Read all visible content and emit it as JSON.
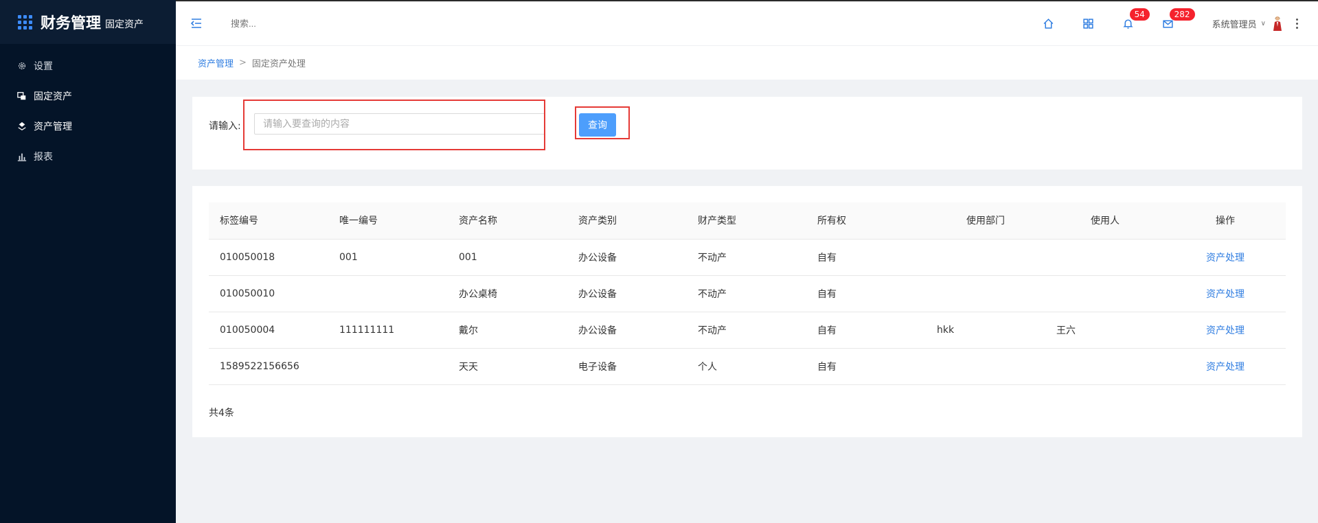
{
  "app": {
    "title": "财务管理",
    "subtitle": "固定资产"
  },
  "sidebar": {
    "items": [
      {
        "label": "设置",
        "icon": "gear-icon"
      },
      {
        "label": "固定资产",
        "icon": "assets-icon"
      },
      {
        "label": "资产管理",
        "icon": "stack-icon"
      },
      {
        "label": "报表",
        "icon": "bar-chart-icon"
      }
    ]
  },
  "header": {
    "search_placeholder": "搜索...",
    "notifications_count": "54",
    "messages_count": "282",
    "user_name": "系统管理员"
  },
  "breadcrumb": {
    "parent": "资产管理",
    "separator": ">",
    "current": "固定资产处理"
  },
  "search": {
    "label": "请输入:",
    "placeholder": "请输入要查询的内容",
    "value": "",
    "button_label": "查询"
  },
  "table": {
    "columns": [
      "标签编号",
      "唯一编号",
      "资产名称",
      "资产类别",
      "财产类型",
      "所有权",
      "使用部门",
      "使用人",
      "操作"
    ],
    "rows": [
      [
        "010050018",
        "001",
        "001",
        "办公设备",
        "不动产",
        "自有",
        "",
        "",
        "资产处理"
      ],
      [
        "010050010",
        "",
        "办公桌椅",
        "办公设备",
        "不动产",
        "自有",
        "",
        "",
        "资产处理"
      ],
      [
        "010050004",
        "111111111",
        "戴尔",
        "办公设备",
        "不动产",
        "自有",
        "hkk",
        "王六",
        "资产处理"
      ],
      [
        "1589522156656",
        "",
        "天天",
        "电子设备",
        "个人",
        "自有",
        "",
        "",
        "资产处理"
      ]
    ],
    "total_text": "共4条"
  },
  "colors": {
    "sidebar_bg": "#041428",
    "accent": "#2f7de1",
    "button": "#4d9efc",
    "badge": "#f5222d",
    "highlight_box": "#e53935"
  }
}
